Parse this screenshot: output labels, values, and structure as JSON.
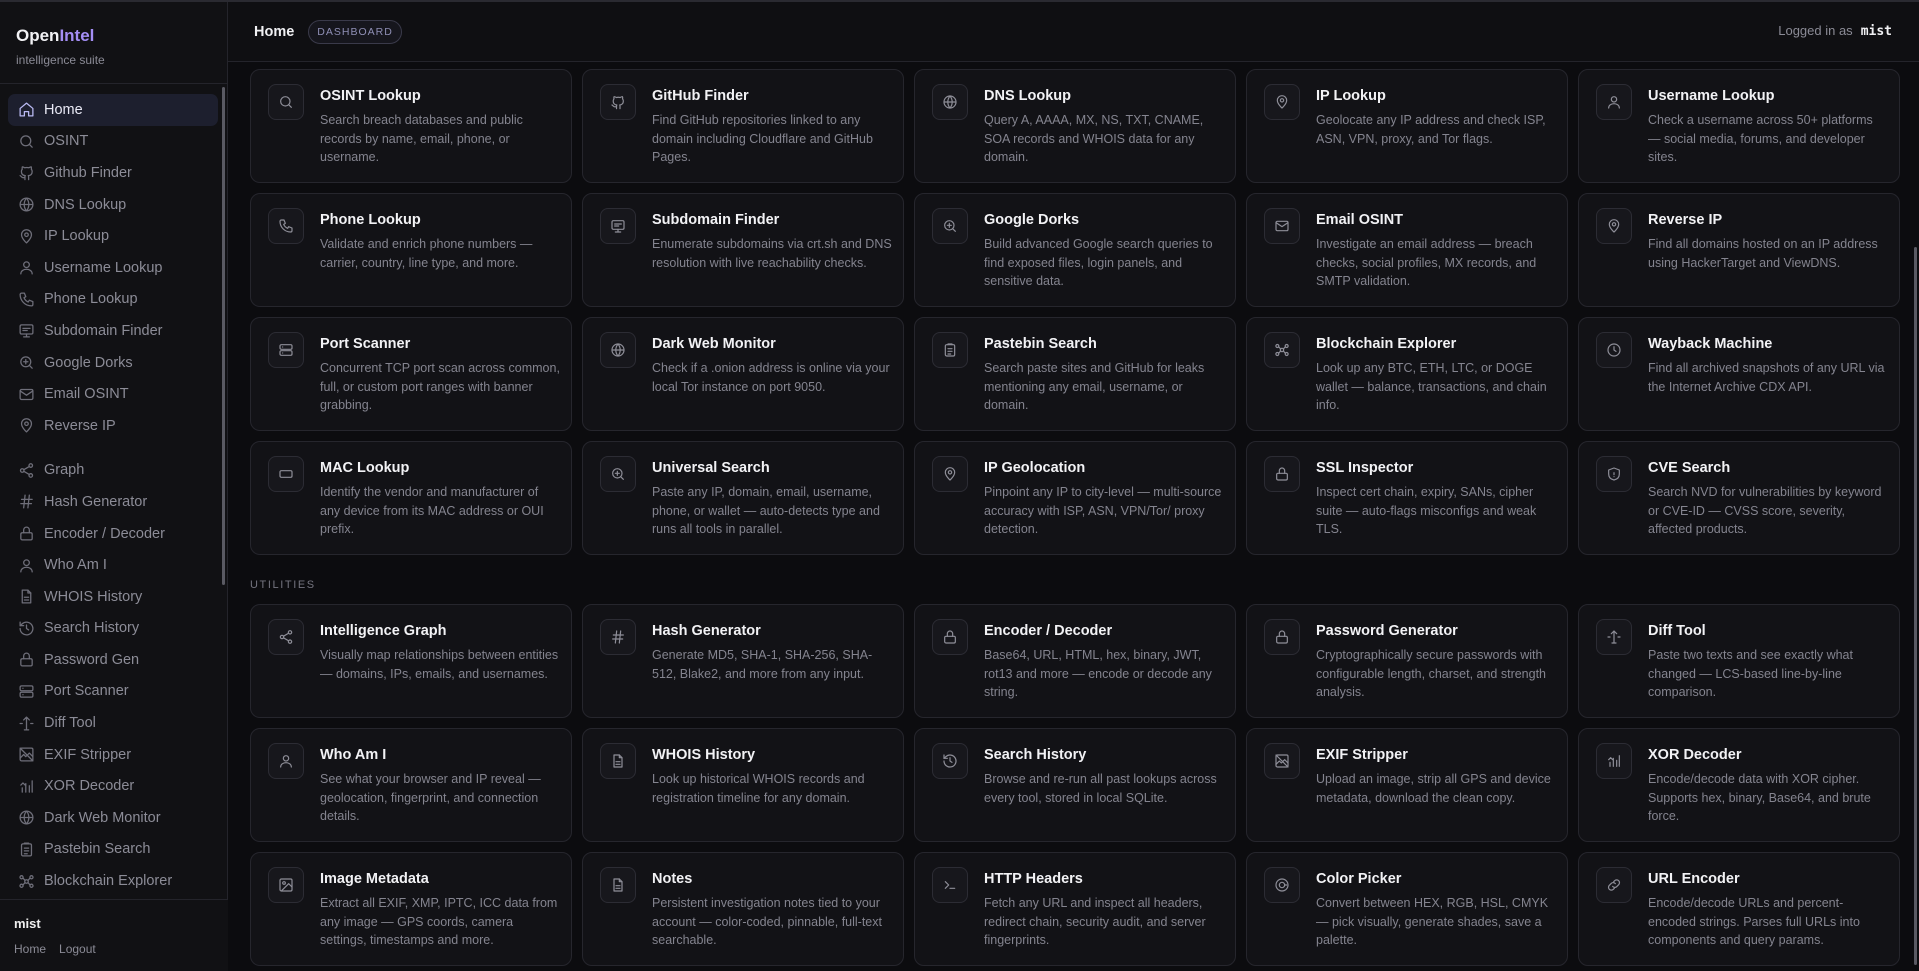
{
  "brand": {
    "name_a": "Open",
    "name_b": "Intel",
    "subtitle": "intelligence suite"
  },
  "topbar": {
    "title": "Home",
    "badge": "DASHBOARD",
    "logged_in_label": "Logged in as",
    "username": "mist"
  },
  "sidebar": {
    "items": [
      {
        "label": "Home",
        "icon": "home-icon",
        "active": true
      },
      {
        "label": "OSINT",
        "icon": "search-icon"
      },
      {
        "label": "Github Finder",
        "icon": "github-icon"
      },
      {
        "label": "DNS Lookup",
        "icon": "globe-icon"
      },
      {
        "label": "IP Lookup",
        "icon": "map-pin-icon"
      },
      {
        "label": "Username Lookup",
        "icon": "user-icon"
      },
      {
        "label": "Phone Lookup",
        "icon": "phone-icon"
      },
      {
        "label": "Subdomain Finder",
        "icon": "monitor-icon"
      },
      {
        "label": "Google Dorks",
        "icon": "zoom-in-icon"
      },
      {
        "label": "Email OSINT",
        "icon": "mail-icon"
      },
      {
        "label": "Reverse IP",
        "icon": "map-pin-icon"
      }
    ],
    "items2": [
      {
        "label": "Graph",
        "icon": "share-icon"
      },
      {
        "label": "Hash Generator",
        "icon": "hash-icon"
      },
      {
        "label": "Encoder / Decoder",
        "icon": "lock-icon"
      },
      {
        "label": "Who Am I",
        "icon": "user-icon"
      },
      {
        "label": "WHOIS History",
        "icon": "file-icon"
      },
      {
        "label": "Search History",
        "icon": "history-icon"
      },
      {
        "label": "Password Gen",
        "icon": "lock-icon"
      },
      {
        "label": "Port Scanner",
        "icon": "server-icon"
      },
      {
        "label": "Diff Tool",
        "icon": "diff-icon"
      },
      {
        "label": "EXIF Stripper",
        "icon": "image-off-icon"
      },
      {
        "label": "XOR Decoder",
        "icon": "bars-icon"
      },
      {
        "label": "Dark Web Monitor",
        "icon": "globe-icon"
      },
      {
        "label": "Pastebin Search",
        "icon": "clipboard-icon"
      },
      {
        "label": "Blockchain Explorer",
        "icon": "blocks-icon"
      }
    ],
    "footer": {
      "user": "mist",
      "links": [
        "Home",
        "Logout"
      ]
    }
  },
  "tools": [
    {
      "title": "OSINT Lookup",
      "desc": "Search breach databases and public records by name, email, phone, or username.",
      "icon": "search-icon"
    },
    {
      "title": "GitHub Finder",
      "desc": "Find GitHub repositories linked to any domain including Cloudflare and GitHub Pages.",
      "icon": "github-icon"
    },
    {
      "title": "DNS Lookup",
      "desc": "Query A, AAAA, MX, NS, TXT, CNAME, SOA records and WHOIS data for any domain.",
      "icon": "globe-icon"
    },
    {
      "title": "IP Lookup",
      "desc": "Geolocate any IP address and check ISP, ASN, VPN, proxy, and Tor flags.",
      "icon": "map-pin-icon"
    },
    {
      "title": "Username Lookup",
      "desc": "Check a username across 50+ platforms — social media, forums, and developer sites.",
      "icon": "user-icon"
    },
    {
      "title": "Phone Lookup",
      "desc": "Validate and enrich phone numbers — carrier, country, line type, and more.",
      "icon": "phone-icon"
    },
    {
      "title": "Subdomain Finder",
      "desc": "Enumerate subdomains via crt.sh and DNS resolution with live reachability checks.",
      "icon": "monitor-icon"
    },
    {
      "title": "Google Dorks",
      "desc": "Build advanced Google search queries to find exposed files, login panels, and sensitive data.",
      "icon": "zoom-in-icon"
    },
    {
      "title": "Email OSINT",
      "desc": "Investigate an email address — breach checks, social profiles, MX records, and SMTP validation.",
      "icon": "mail-icon"
    },
    {
      "title": "Reverse IP",
      "desc": "Find all domains hosted on an IP address using HackerTarget and ViewDNS.",
      "icon": "map-pin-icon"
    },
    {
      "title": "Port Scanner",
      "desc": "Concurrent TCP port scan across common, full, or custom port ranges with banner grabbing.",
      "icon": "server-icon"
    },
    {
      "title": "Dark Web Monitor",
      "desc": "Check if a .onion address is online via your local Tor instance on port 9050.",
      "icon": "globe-icon"
    },
    {
      "title": "Pastebin Search",
      "desc": "Search paste sites and GitHub for leaks mentioning any email, username, or domain.",
      "icon": "clipboard-icon"
    },
    {
      "title": "Blockchain Explorer",
      "desc": "Look up any BTC, ETH, LTC, or DOGE wallet — balance, transactions, and chain info.",
      "icon": "blocks-icon"
    },
    {
      "title": "Wayback Machine",
      "desc": "Find all archived snapshots of any URL via the Internet Archive CDX API.",
      "icon": "clock-icon"
    },
    {
      "title": "MAC Lookup",
      "desc": "Identify the vendor and manufacturer of any device from its MAC address or OUI prefix.",
      "icon": "card-icon"
    },
    {
      "title": "Universal Search",
      "desc": "Paste any IP, domain, email, username, phone, or wallet — auto-detects type and runs all tools in parallel.",
      "icon": "zoom-in-icon"
    },
    {
      "title": "IP Geolocation",
      "desc": "Pinpoint any IP to city-level — multi-source accuracy with ISP, ASN, VPN/Tor/ proxy detection.",
      "icon": "map-pin-icon"
    },
    {
      "title": "SSL Inspector",
      "desc": "Inspect cert chain, expiry, SANs, cipher suite — auto-flags misconfigs and weak TLS.",
      "icon": "lock-icon"
    },
    {
      "title": "CVE Search",
      "desc": "Search NVD for vulnerabilities by keyword or CVE-ID — CVSS score, severity, affected products.",
      "icon": "shield-icon"
    }
  ],
  "utilities_heading": "UTILITIES",
  "utilities": [
    {
      "title": "Intelligence Graph",
      "desc": "Visually map relationships between entities — domains, IPs, emails, and usernames.",
      "icon": "share-icon"
    },
    {
      "title": "Hash Generator",
      "desc": "Generate MD5, SHA-1, SHA-256, SHA-512, Blake2, and more from any input.",
      "icon": "hash-icon"
    },
    {
      "title": "Encoder / Decoder",
      "desc": "Base64, URL, HTML, hex, binary, JWT, rot13 and more — encode or decode any string.",
      "icon": "lock-icon"
    },
    {
      "title": "Password Generator",
      "desc": "Cryptographically secure passwords with configurable length, charset, and strength analysis.",
      "icon": "lock-icon"
    },
    {
      "title": "Diff Tool",
      "desc": "Paste two texts and see exactly what changed — LCS-based line-by-line comparison.",
      "icon": "diff-icon"
    },
    {
      "title": "Who Am I",
      "desc": "See what your browser and IP reveal — geolocation, fingerprint, and connection details.",
      "icon": "user-icon"
    },
    {
      "title": "WHOIS History",
      "desc": "Look up historical WHOIS records and registration timeline for any domain.",
      "icon": "file-icon"
    },
    {
      "title": "Search History",
      "desc": "Browse and re-run all past lookups across every tool, stored in local SQLite.",
      "icon": "history-icon"
    },
    {
      "title": "EXIF Stripper",
      "desc": "Upload an image, strip all GPS and device metadata, download the clean copy.",
      "icon": "image-off-icon"
    },
    {
      "title": "XOR Decoder",
      "desc": "Encode/decode data with XOR cipher. Supports hex, binary, Base64, and brute force.",
      "icon": "bars-icon"
    },
    {
      "title": "Image Metadata",
      "desc": "Extract all EXIF, XMP, IPTC, ICC data from any image — GPS coords, camera settings, timestamps and more.",
      "icon": "image-icon"
    },
    {
      "title": "Notes",
      "desc": "Persistent investigation notes tied to your account — color-coded, pinnable, full-text searchable.",
      "icon": "file-icon"
    },
    {
      "title": "HTTP Headers",
      "desc": "Fetch any URL and inspect all headers, redirect chain, security audit, and server fingerprints.",
      "icon": "terminal-icon"
    },
    {
      "title": "Color Picker",
      "desc": "Convert between HEX, RGB, HSL, CMYK — pick visually, generate shades, save a palette.",
      "icon": "target-icon"
    },
    {
      "title": "URL Encoder",
      "desc": "Encode/decode URLs and percent-encoded strings. Parses full URLs into components and query params.",
      "icon": "link-icon"
    }
  ]
}
